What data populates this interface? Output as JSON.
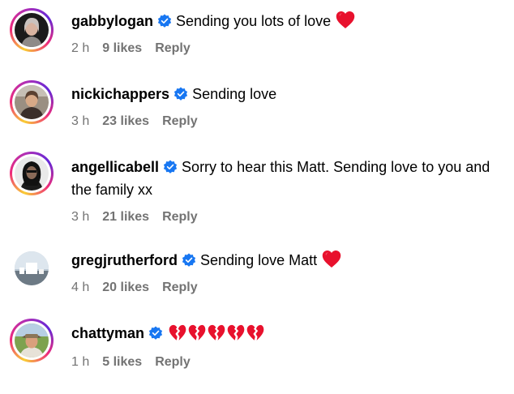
{
  "comments": [
    {
      "username": "gabbylogan",
      "text": "Sending you lots of love",
      "emoji": "red-heart",
      "time": "2 h",
      "likes": "9 likes",
      "reply": "Reply"
    },
    {
      "username": "nickichappers",
      "text": "Sending love",
      "emoji": "",
      "time": "3 h",
      "likes": "23 likes",
      "reply": "Reply"
    },
    {
      "username": "angellicabell",
      "text": "Sorry to hear this Matt. Sending love to you and the family xx",
      "emoji": "",
      "time": "3 h",
      "likes": "21 likes",
      "reply": "Reply"
    },
    {
      "username": "gregjrutherford",
      "text": "Sending love Matt",
      "emoji": "red-heart",
      "time": "4 h",
      "likes": "20 likes",
      "reply": "Reply"
    },
    {
      "username": "chattyman",
      "text": "",
      "emoji": "broken-heart x5",
      "time": "1 h",
      "likes": "5 likes",
      "reply": "Reply"
    }
  ],
  "colors": {
    "verified": "#1877f2",
    "heart": "#e8112d",
    "meta": "#737373"
  }
}
